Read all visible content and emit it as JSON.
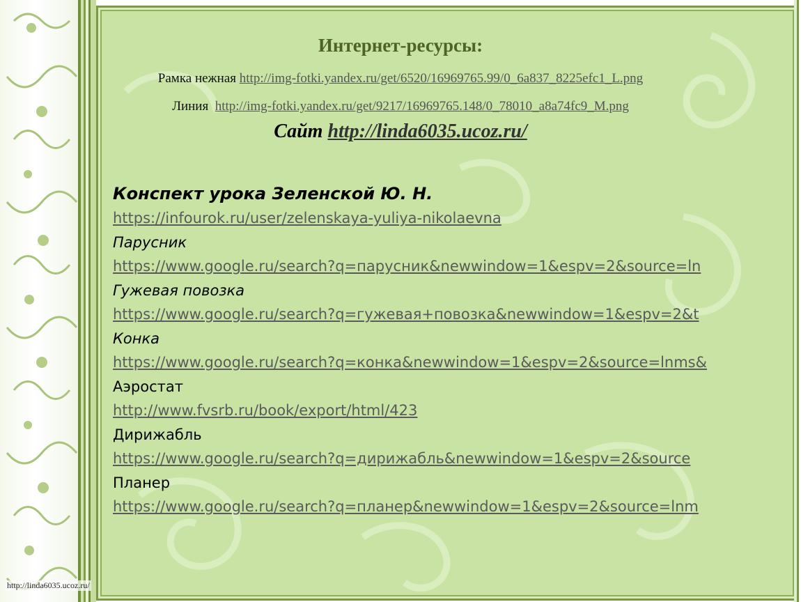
{
  "title": "Интернет-ресурсы:",
  "frame_line": {
    "label": "Рамка нежная",
    "url": "http://img-fotki.yandex.ru/get/6520/16969765.99/0_6a837_8225efc1_L.png"
  },
  "divider_line": {
    "label": "Линия",
    "url": "http://img-fotki.yandex.ru/get/9217/16969765.148/0_78010_a8a74fc9_M.png"
  },
  "site_line": {
    "label": "Сайт",
    "url": "http://linda6035.ucoz.ru/"
  },
  "lesson": {
    "heading": "Конспект урока Зеленской Ю. Н.",
    "url": "https://infourok.ru/user/zelenskaya-yuliya-nikolaevna"
  },
  "resources": [
    {
      "label": "Парусник",
      "url": "https://www.google.ru/search?q=парусник&newwindow=1&espv=2&source=ln"
    },
    {
      "label": "Гужевая повозка",
      "url": "https://www.google.ru/search?q=гужевая+повозка&newwindow=1&espv=2&t"
    },
    {
      "label": "Конка",
      "url": "https://www.google.ru/search?q=конка&newwindow=1&espv=2&source=lnms&"
    },
    {
      "label": "Аэростат",
      "url": "http://www.fvsrb.ru/book/export/html/423"
    },
    {
      "label": "Дирижабль",
      "url": "https://www.google.ru/search?q=дирижабль&newwindow=1&espv=2&source"
    },
    {
      "label": "Планер",
      "url": "https://www.google.ru/search?q=планер&newwindow=1&espv=2&source=lnm"
    }
  ],
  "footer_url": "http://linda6035.ucoz.ru/",
  "colors": {
    "panel_background": "#c8e3a4",
    "title_color": "#4f6228",
    "border_green": "#7a9a45"
  }
}
